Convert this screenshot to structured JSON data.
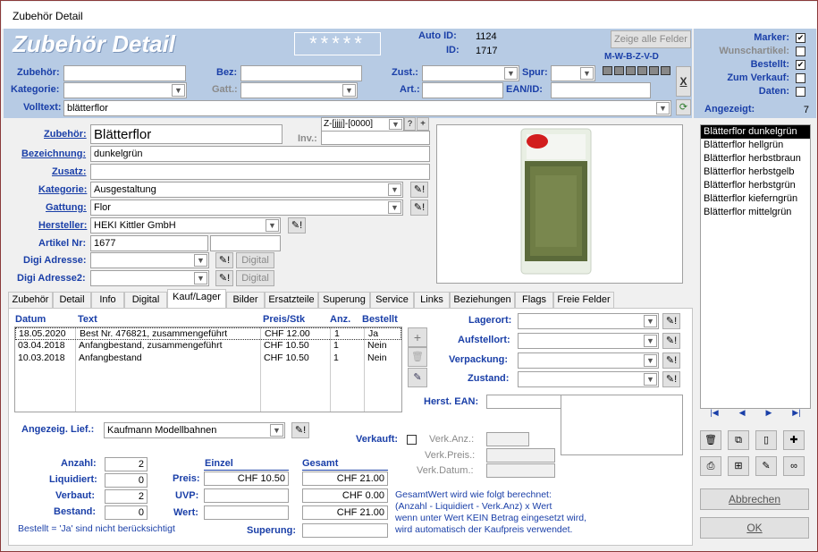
{
  "window": {
    "title": "Zubehör Detail"
  },
  "header": {
    "title": "Zubehör Detail",
    "stars": "*****",
    "auto_id_label": "Auto ID:",
    "auto_id": "1124",
    "id_label": "ID:",
    "id": "1717",
    "show_all_button": "Zeige alle Felder",
    "mwbzvd": "M-W-B-Z-V-D",
    "x_label": "X"
  },
  "filters": {
    "zubehoer_label": "Zubehör:",
    "bez_label": "Bez:",
    "zust_label": "Zust.:",
    "spur_label": "Spur:",
    "kategorie_label": "Kategorie:",
    "gatt_label": "Gatt.:",
    "art_label": "Art.:",
    "ean_label": "EAN/ID:",
    "volltext_label": "Volltext:",
    "volltext_value": "blätterflor"
  },
  "flags": {
    "marker_label": "Marker:",
    "marker": true,
    "wunsch_label": "Wunschartikel:",
    "wunsch": false,
    "bestellt_label": "Bestellt:",
    "bestellt": true,
    "verkauf_label": "Zum Verkauf:",
    "verkauf": false,
    "daten_label": "Daten:",
    "daten": false,
    "angezeigt_label": "Angezeigt:",
    "angezeigt": "7"
  },
  "detail": {
    "zubehoer_label": "Zubehör:",
    "zubehoer_value": "Blätterflor",
    "inv_format": "Z-[jjjj]-[0000]",
    "inv_label": "Inv.:",
    "bezeichnung_label": "Bezeichnung:",
    "bezeichnung_value": "dunkelgrün",
    "zusatz_label": "Zusatz:",
    "kategorie_label": "Kategorie:",
    "kategorie_value": "Ausgestaltung",
    "gattung_label": "Gattung:",
    "gattung_value": "Flor",
    "hersteller_label": "Hersteller:",
    "hersteller_value": "HEKI Kittler GmbH",
    "artikel_label": "Artikel Nr:",
    "artikel_value": "1677",
    "digi1_label": "Digi Adresse:",
    "digi2_label": "Digi Adresse2:",
    "digital_button": "Digital"
  },
  "results": [
    "Blätterflor dunkelgrün",
    "Blätterflor hellgrün",
    "Blätterflor herbstbraun",
    "Blätterflor herbstgelb",
    "Blätterflor herbstgrün",
    "Blätterflor kieferngrün",
    "Blätterflor mittelgrün"
  ],
  "tabs": [
    "Zubehör",
    "Detail",
    "Info",
    "Digital",
    "Kauf/Lager",
    "Bilder",
    "Ersatzteile",
    "Superung",
    "Service",
    "Links",
    "Beziehungen",
    "Flags",
    "Freie Felder"
  ],
  "purchases": {
    "headers": {
      "datum": "Datum",
      "text": "Text",
      "preis": "Preis/Stk",
      "anz": "Anz.",
      "bestellt": "Bestellt"
    },
    "rows": [
      {
        "datum": "18.05.2020",
        "text": "Best Nr. 476821, zusammengeführt",
        "preis": "CHF 12.00",
        "anz": "1",
        "bestellt": "Ja"
      },
      {
        "datum": "03.04.2018",
        "text": "Anfangbestand, zusammengeführt",
        "preis": "CHF 10.50",
        "anz": "1",
        "bestellt": "Nein"
      },
      {
        "datum": "10.03.2018",
        "text": "Anfangbestand",
        "preis": "CHF 10.50",
        "anz": "1",
        "bestellt": "Nein"
      }
    ]
  },
  "lager": {
    "lagerort_label": "Lagerort:",
    "aufstellort_label": "Aufstellort:",
    "verpackung_label": "Verpackung:",
    "zustand_label": "Zustand:",
    "herst_ean_label": "Herst. EAN:"
  },
  "lieferant": {
    "label": "Angezeig. Lief.:",
    "value": "Kaufmann Modellbahnen"
  },
  "verkauf": {
    "verkauft_label": "Verkauft:",
    "anz_label": "Verk.Anz.:",
    "preis_label": "Verk.Preis.:",
    "datum_label": "Verk.Datum.:"
  },
  "counts": {
    "anzahl_label": "Anzahl:",
    "anzahl": "2",
    "liquidiert_label": "Liquidiert:",
    "liquidiert": "0",
    "verbaut_label": "Verbaut:",
    "verbaut": "2",
    "bestand_label": "Bestand:",
    "bestand": "0",
    "note": "Bestellt = 'Ja' sind nicht berücksichtigt"
  },
  "prices": {
    "einzel_header": "Einzel",
    "gesamt_header": "Gesamt",
    "preis_label": "Preis:",
    "preis_einzel": "CHF 10.50",
    "preis_gesamt": "CHF 21.00",
    "uvp_label": "UVP:",
    "uvp_gesamt": "CHF 0.00",
    "wert_label": "Wert:",
    "wert_gesamt": "CHF 21.00",
    "superung_label": "Superung:"
  },
  "explanation": [
    "GesamtWert wird wie folgt berechnet:",
    "(Anzahl - Liquidiert - Verk.Anz) x Wert",
    "wenn unter Wert KEIN Betrag eingesetzt wird,",
    "wird automatisch der Kaufpreis verwendet."
  ],
  "actions": {
    "cancel": "Abbrechen",
    "ok": "OK"
  },
  "colors": {
    "header_bg": "#b7cbe4",
    "label_blue": "#1a3fa8"
  }
}
